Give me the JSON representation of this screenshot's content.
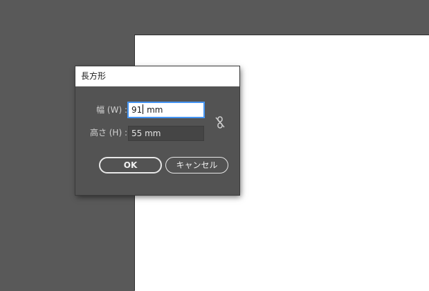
{
  "dialog": {
    "title": "長方形",
    "width_label": "幅 (W) :",
    "height_label": "高さ (H) :",
    "width_value_before_caret": "91",
    "width_value_after_caret": " mm",
    "height_value": "55 mm",
    "link_icon": "unlinked-chain-icon",
    "ok_label": "OK",
    "cancel_label": "キャンセル"
  },
  "colors": {
    "canvas_background": "#595959",
    "artboard": "#ffffff",
    "dialog_background": "#535353",
    "focus_border": "#3d8ff0"
  }
}
